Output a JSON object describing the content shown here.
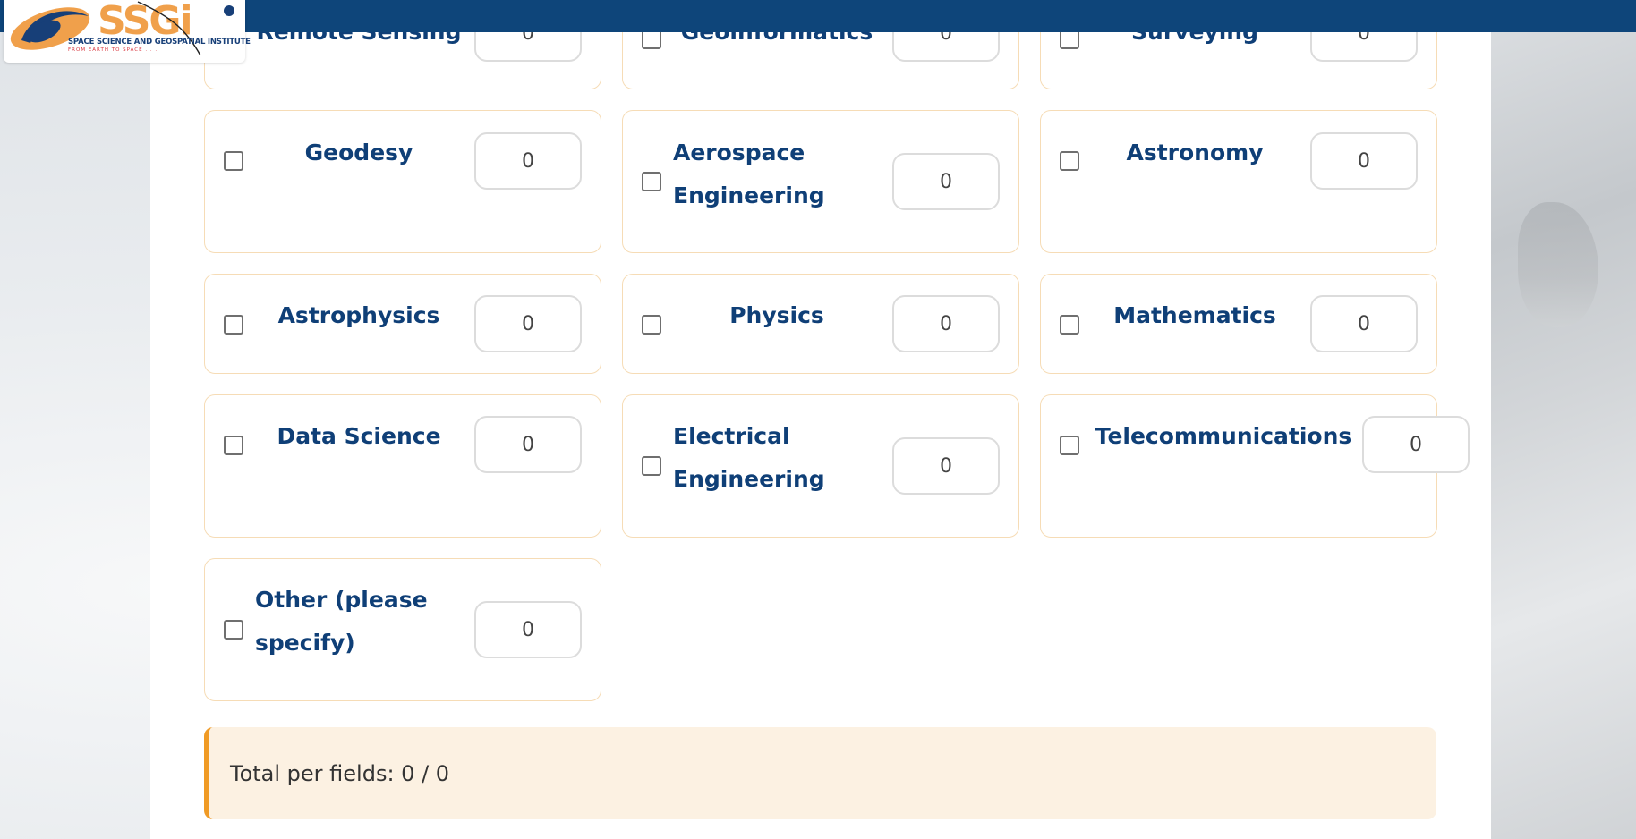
{
  "logo": {
    "name": "SSGi",
    "subtitle": "SPACE SCIENCE AND GEOSPATIAL INSTITUTE",
    "tagline": "FROM EARTH TO SPACE . . ."
  },
  "fields": [
    {
      "label": "Remote Sensing",
      "value": "0",
      "checked": false
    },
    {
      "label": "Geoinformatics",
      "value": "0",
      "checked": false
    },
    {
      "label": "Surveying",
      "value": "0",
      "checked": false
    },
    {
      "label": "Geodesy",
      "value": "0",
      "checked": false
    },
    {
      "label": "Aerospace Engineering",
      "value": "0",
      "checked": false
    },
    {
      "label": "Astronomy",
      "value": "0",
      "checked": false
    },
    {
      "label": "Astrophysics",
      "value": "0",
      "checked": false
    },
    {
      "label": "Physics",
      "value": "0",
      "checked": false
    },
    {
      "label": "Mathematics",
      "value": "0",
      "checked": false
    },
    {
      "label": "Data Science",
      "value": "0",
      "checked": false
    },
    {
      "label": "Electrical Engineering",
      "value": "0",
      "checked": false
    },
    {
      "label": "Telecommunications",
      "value": "0",
      "checked": false
    },
    {
      "label": "Other (please specify)",
      "value": "0",
      "checked": false
    }
  ],
  "total": {
    "text": "Total per fields: 0 / 0"
  },
  "colors": {
    "header": "#0e457a",
    "label": "#0f3f77",
    "card_border": "#f6dcb6",
    "accent": "#f09a24",
    "total_bg": "#fcf1e2"
  }
}
